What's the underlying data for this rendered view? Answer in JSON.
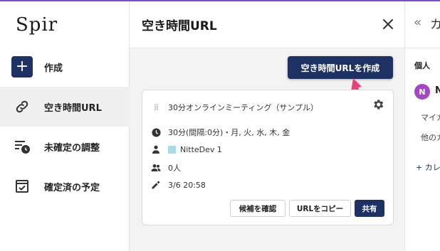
{
  "app": {
    "logo_text": "Spir",
    "brand_color": "#1d3162",
    "accent_top_color": "#7b4fc8"
  },
  "sidebar": {
    "items": [
      {
        "label": "作成",
        "icon": "plus-icon",
        "active": false
      },
      {
        "label": "空き時間URL",
        "icon": "link-icon",
        "active": true
      },
      {
        "label": "未確定の調整",
        "icon": "pending-schedule-icon",
        "active": false
      },
      {
        "label": "確定済の予定",
        "icon": "calendar-check-icon",
        "active": false
      }
    ]
  },
  "panel": {
    "title": "空き時間URL",
    "create_button": "空き時間URLを作成",
    "card": {
      "title": "30分オンラインミーティング（サンプル）",
      "duration": "30分(間隔:0分)・月, 火, 水, 木, 金",
      "calendar": "NitteDev 1",
      "calendar_color": "#a8dce8",
      "attendees": "0人",
      "updated": "3/6 20:58",
      "buttons": {
        "check_candidates": "候補を確認",
        "copy_url": "URLをコピー",
        "share": "共有"
      }
    }
  },
  "right_panel": {
    "collapse_glyph": "«",
    "title": "カ",
    "section": "個人",
    "avatar_letter": "N",
    "user_initial": "N",
    "item_1": "マイカ",
    "item_2": "他のカ",
    "add_link": "+ カレ"
  }
}
